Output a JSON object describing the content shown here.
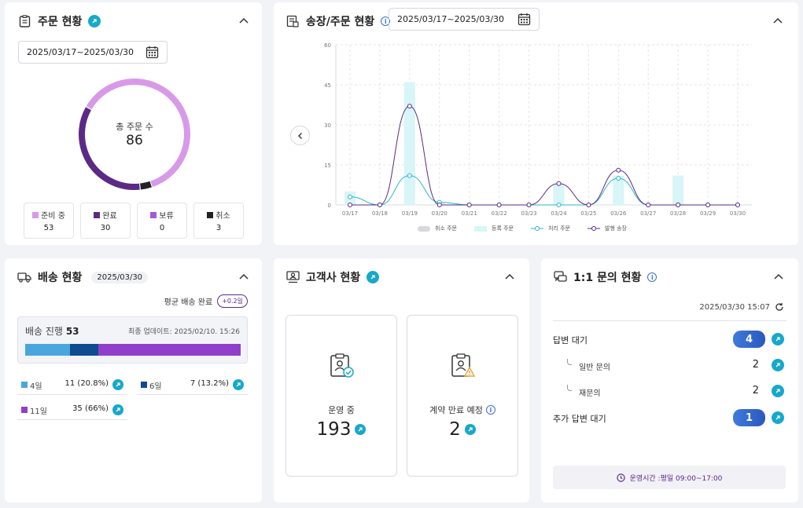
{
  "orders": {
    "title": "주문 현황",
    "date_range": "2025/03/17~2025/03/30",
    "total_label": "총 주문 수",
    "total_value": "86",
    "stats": [
      {
        "label": "준비 중",
        "value": "53",
        "color": "#d89ae8"
      },
      {
        "label": "완료",
        "value": "30",
        "color": "#5b2a86"
      },
      {
        "label": "보류",
        "value": "0",
        "color": "#a35ad6"
      },
      {
        "label": "취소",
        "value": "3",
        "color": "#222222"
      }
    ]
  },
  "invoice": {
    "title": "송장/주문 현황",
    "date_range": "2025/03/17~2025/03/30",
    "chart_data": {
      "type": "line",
      "categories": [
        "03/17",
        "03/18",
        "03/19",
        "03/20",
        "03/21",
        "03/22",
        "03/23",
        "03/24",
        "03/25",
        "03/26",
        "03/27",
        "03/28",
        "03/29",
        "03/30"
      ],
      "ylim": [
        0,
        60
      ],
      "yticks": [
        "0",
        "15",
        "30",
        "45",
        "60"
      ],
      "series": [
        {
          "name": "취소 주문",
          "kind": "bar",
          "color": "#d6d8dc",
          "values": [
            0,
            0,
            0,
            0,
            0,
            0,
            0,
            0,
            0,
            0,
            0,
            0,
            0,
            0
          ]
        },
        {
          "name": "등록 주문",
          "kind": "bar",
          "color": "#d8f5f8",
          "values": [
            5,
            0,
            46,
            1,
            0,
            0,
            0,
            8,
            0,
            11,
            0,
            11,
            0,
            0
          ]
        },
        {
          "name": "처리 주문",
          "kind": "line",
          "color": "#2bb6cb",
          "values": [
            3,
            0,
            11,
            1,
            0,
            0,
            0,
            0,
            0,
            10,
            0,
            0,
            0,
            0
          ]
        },
        {
          "name": "발행 송장",
          "kind": "line",
          "color": "#5b2a86",
          "values": [
            0,
            0,
            37,
            0,
            0,
            0,
            0,
            8,
            0,
            13,
            0,
            0,
            0,
            0
          ]
        }
      ]
    }
  },
  "delivery": {
    "title": "배송 현황",
    "date": "2025/03/30",
    "avg_label": "평균 배송 완료",
    "avg_badge": "+0.2일",
    "progress_label": "배송 진행",
    "progress_count": "53",
    "updated": "최종 업데이트: 2025/02/10. 15:26",
    "segments": [
      {
        "fraction": 0.208,
        "color": "#4aa7dc"
      },
      {
        "fraction": 0.132,
        "color": "#0f4b8f"
      },
      {
        "fraction": 0.66,
        "color": "#8f3fc9"
      }
    ],
    "items": [
      {
        "label": "4일",
        "value": "11 (20.8%)",
        "color": "#4aa7dc"
      },
      {
        "label": "6일",
        "value": "7 (13.2%)",
        "color": "#0f4b8f"
      },
      {
        "label": "11일",
        "value": "35 (66%)",
        "color": "#8f3fc9"
      }
    ]
  },
  "clients": {
    "title": "고객사 현황",
    "active_label": "운영 중",
    "active_value": "193",
    "expiring_label": "계약 만료 예정",
    "expiring_value": "2"
  },
  "inquiries": {
    "title": "1:1 문의 현황",
    "timestamp": "2025/03/30 15:07",
    "waiting_label": "답변 대기",
    "waiting_value": "4",
    "general_label": "일반 문의",
    "general_value": "2",
    "reinquiry_label": "재문의",
    "reinquiry_value": "2",
    "extra_label": "추가 답변 대기",
    "extra_value": "1",
    "hours": "운영시간 :평일 09:00~17:00"
  }
}
